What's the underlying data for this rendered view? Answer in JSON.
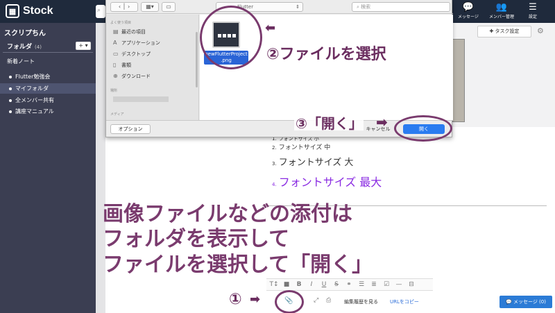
{
  "app": {
    "name": "Stock"
  },
  "topbar": {
    "message": "メッセージ",
    "members": "メンバー管理",
    "settings": "設定"
  },
  "sidebar": {
    "workspace": "スクリプちん",
    "folder_header": "フォルダ",
    "folder_count": "(4)",
    "add_btn": "+ ▾",
    "new_notes": "新着ノート",
    "folders": [
      {
        "label": "Flutter勉強会"
      },
      {
        "label": "マイフォルダ"
      },
      {
        "label": "全メンバー共有"
      },
      {
        "label": "講座マニュアル"
      }
    ]
  },
  "editor": {
    "task_button": "タスク設定",
    "list": [
      {
        "num": "1.",
        "text": "フォントサイズ 小"
      },
      {
        "num": "2.",
        "text": "フォントサイズ 中"
      },
      {
        "num": "3.",
        "text": "フォントサイズ 大"
      },
      {
        "num": "4.",
        "text": "フォントサイズ 最大"
      }
    ],
    "edit_history": "編集履歴を見る",
    "copy_url": "URLをコピー",
    "message_btn": "メッセージ (0)"
  },
  "dialog": {
    "path": "Flutter",
    "search_placeholder": "検索",
    "favorites_header": "よく使う項目",
    "sidebar_items": [
      {
        "label": "最近の項目"
      },
      {
        "label": "アプリケーション"
      },
      {
        "label": "デスクトップ"
      },
      {
        "label": "書類"
      },
      {
        "label": "ダウンロード"
      }
    ],
    "locations_header": "場所",
    "media_header": "メディア",
    "file_name": "newFlutterProject .png",
    "options": "オプション",
    "cancel": "キャンセル",
    "open": "開く"
  },
  "annotations": {
    "step1": "①",
    "step2": "②ファイルを選択",
    "step3": "③「開く」",
    "line1": "画像ファイルなどの添付は",
    "line2": "フォルダを表示して",
    "line3": "ファイルを選択して「開く」"
  },
  "colors": {
    "annotation": "#7a3b6e",
    "sidebar": "#3b3e52",
    "topbar": "#1f2a3c",
    "open_button": "#2a7cf0"
  }
}
